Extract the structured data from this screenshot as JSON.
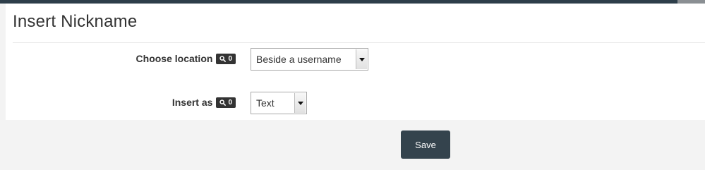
{
  "dialog": {
    "title": "Insert Nickname"
  },
  "fields": [
    {
      "label": "Choose location",
      "badge_count": "0",
      "badge_icon": "search-icon",
      "selected": "Beside a username"
    },
    {
      "label": "Insert as",
      "badge_count": "0",
      "badge_icon": "search-icon",
      "selected": "Text"
    }
  ],
  "footer": {
    "save_label": "Save"
  },
  "colors": {
    "top_strip": "#2d3e4a",
    "badge_bg": "#333333",
    "button_bg": "#34434d",
    "footer_bg": "#f3f3f3"
  }
}
